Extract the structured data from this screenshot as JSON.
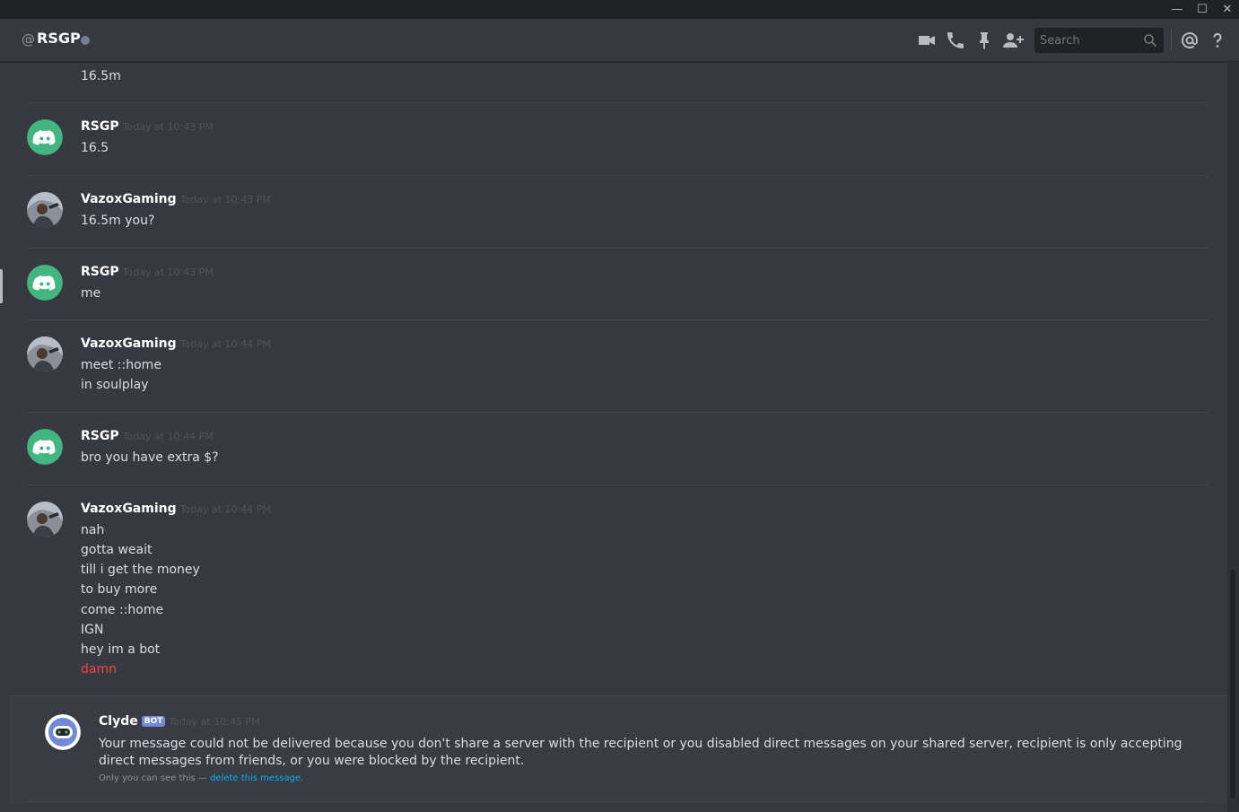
{
  "header": {
    "at_symbol": "@",
    "channel_name": "RSGP",
    "search_placeholder": "Search"
  },
  "window": {
    "minimize": "—",
    "maximize": "☐",
    "close": "✕"
  },
  "colors": {
    "background": "#36393f",
    "discord_green": "#43b581",
    "blurple": "#7289da",
    "red_text": "#f04747",
    "link": "#00b0f4"
  },
  "messages": [
    {
      "lines": [
        "16.5m"
      ]
    },
    {
      "author": "RSGP",
      "timestamp": "Today at 10:43 PM",
      "lines": [
        "16.5"
      ]
    },
    {
      "author": "VazoxGaming",
      "timestamp": "Today at 10:43 PM",
      "lines": [
        "16.5m you?"
      ]
    },
    {
      "author": "RSGP",
      "timestamp": "Today at 10:43 PM",
      "lines": [
        "me"
      ]
    },
    {
      "author": "VazoxGaming",
      "timestamp": "Today at 10:44 PM",
      "lines": [
        "meet ::home",
        "in soulplay"
      ]
    },
    {
      "author": "RSGP",
      "timestamp": "Today at 10:44 PM",
      "lines": [
        "bro you have extra $?"
      ]
    },
    {
      "author": "VazoxGaming",
      "timestamp": "Today at 10:44 PM",
      "lines": [
        "nah",
        "gotta weait",
        "till i get the money",
        "to buy more",
        "come ::home",
        "IGN",
        "hey im a bot",
        "damn"
      ]
    }
  ],
  "clyde": {
    "author": "Clyde",
    "bot_tag": "BOT",
    "timestamp": "Today at 10:45 PM",
    "text": "Your message could not be delivered because you don't share a server with the recipient or you disabled direct messages on your shared server, recipient is only accepting direct messages from friends, or you were blocked by the recipient.",
    "only_you": "Only you can see this — ",
    "delete_link": "delete this message."
  }
}
